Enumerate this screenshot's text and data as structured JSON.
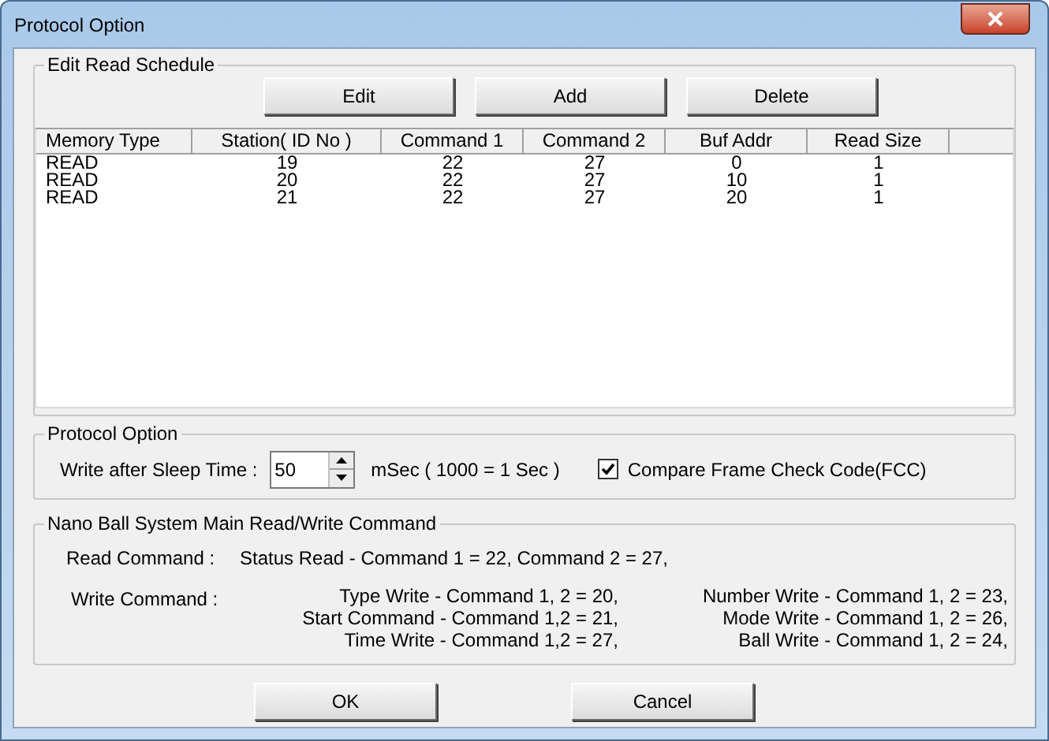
{
  "window": {
    "title": "Protocol Option"
  },
  "read_schedule": {
    "title": "Edit Read Schedule",
    "buttons": [
      "Edit",
      "Add",
      "Delete"
    ],
    "columns": [
      "Memory Type",
      "Station( ID No )",
      "Command 1",
      "Command 2",
      "Buf Addr",
      "Read Size"
    ],
    "rows": [
      [
        "READ",
        "19",
        "22",
        "27",
        "0",
        "1"
      ],
      [
        "READ",
        "20",
        "22",
        "27",
        "10",
        "1"
      ],
      [
        "READ",
        "21",
        "22",
        "27",
        "20",
        "1"
      ]
    ]
  },
  "protocol_option": {
    "title": "Protocol Option",
    "sleep_label": "Write after Sleep Time :",
    "sleep_value": "50",
    "unit": "mSec ( 1000 = 1 Sec )",
    "fcc": {
      "label": "Compare Frame Check Code(FCC)",
      "checked": true
    }
  },
  "commands": {
    "title": "Nano Ball System Main Read/Write Command",
    "read_label": "Read Command :",
    "read_text": "Status Read - Command 1 = 22, Command 2 = 27,",
    "write_label": "Write Command :",
    "write_left": [
      "Type Write - Command 1, 2 = 20,",
      "Start Command - Command 1,2 = 21,",
      "Time Write - Command 1,2 = 27,"
    ],
    "write_right": [
      "Number Write - Command 1, 2 = 23,",
      "Mode Write - Command 1, 2 = 26,",
      "Ball Write - Command 1, 2 = 24,"
    ]
  },
  "buttons": [
    "OK",
    "Cancel"
  ]
}
